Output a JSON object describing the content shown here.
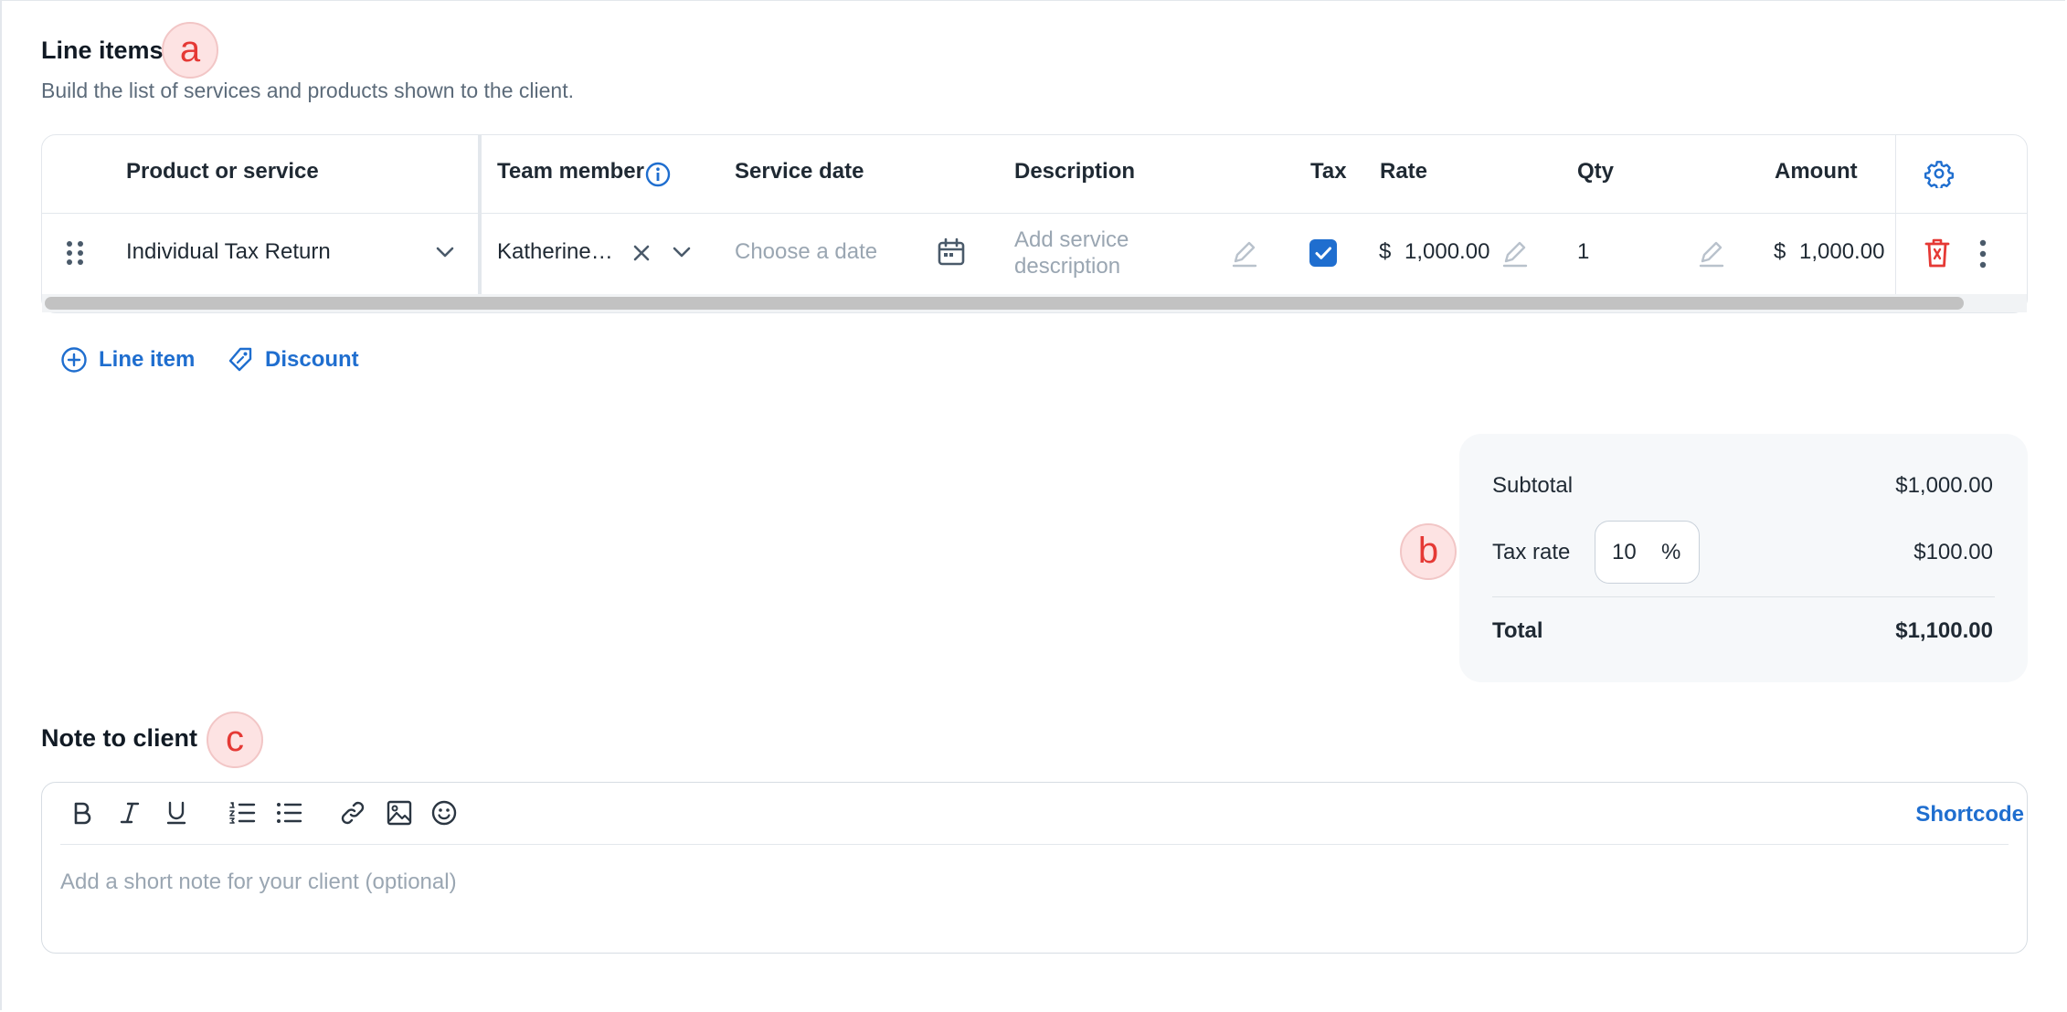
{
  "line_items": {
    "title": "Line items",
    "subtitle": "Build the list of services and products shown to the client.",
    "badge": "a",
    "columns": {
      "product": "Product or service",
      "team_member": "Team member",
      "service_date": "Service date",
      "description": "Description",
      "tax": "Tax",
      "rate": "Rate",
      "qty": "Qty",
      "amount": "Amount"
    },
    "row": {
      "product": "Individual Tax Return",
      "team_member": "Katherine…",
      "service_date_placeholder": "Choose a date",
      "description_placeholder_line1": "Add service",
      "description_placeholder_line2": "description",
      "tax_checked": true,
      "currency": "$",
      "rate": "1,000.00",
      "qty": "1",
      "amount": "1,000.00"
    },
    "add_line_item": "Line item",
    "add_discount": "Discount"
  },
  "totals": {
    "badge": "b",
    "subtotal_label": "Subtotal",
    "subtotal_value": "$1,000.00",
    "tax_rate_label": "Tax rate",
    "tax_rate_value": "10",
    "tax_rate_unit": "%",
    "tax_value": "$100.00",
    "total_label": "Total",
    "total_value": "$1,100.00"
  },
  "note": {
    "title": "Note to client",
    "badge": "c",
    "placeholder": "Add a short note for your client (optional)",
    "shortcode": "Shortcode"
  },
  "colors": {
    "accent": "#1f6ecf",
    "danger": "#e53935",
    "badge_bg": "#fde3e3"
  }
}
